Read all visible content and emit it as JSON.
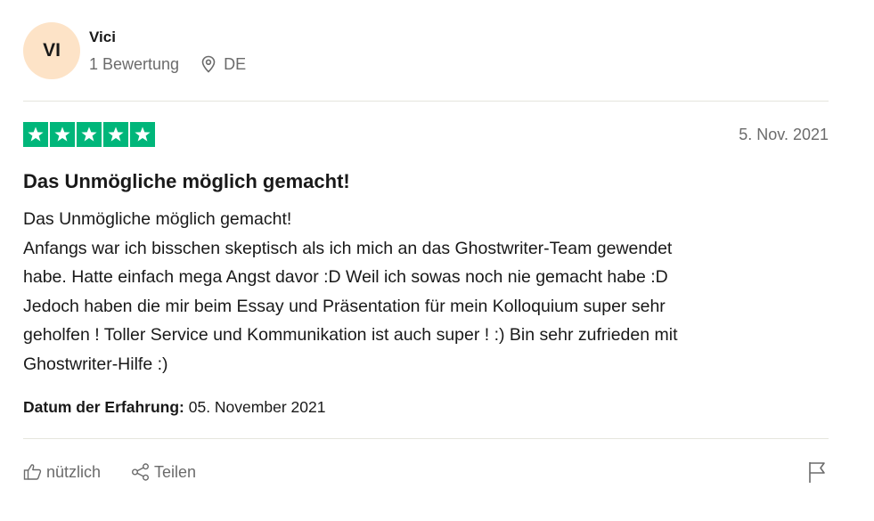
{
  "consumer": {
    "initials": "VI",
    "name": "Vici",
    "review_count": "1 Bewertung",
    "country": "DE"
  },
  "review": {
    "rating": 5,
    "date": "5. Nov. 2021",
    "title": "Das Unmögliche möglich gemacht!",
    "body_lines": [
      "Das Unmögliche möglich gemacht!",
      "Anfangs war ich bisschen skeptisch als ich mich an das Ghostwriter-Team gewendet",
      "habe. Hatte einfach mega Angst davor :D Weil ich sowas noch nie gemacht habe :D",
      "Jedoch haben die mir beim Essay und Präsentation für mein Kolloquium super sehr",
      "geholfen ! Toller Service und Kommunikation ist auch super ! :) Bin sehr zufrieden mit",
      "Ghostwriter-Hilfe :)"
    ],
    "experience_label": "Datum der Erfahrung:",
    "experience_date": "05. November 2021"
  },
  "actions": {
    "useful_label": "nützlich",
    "share_label": "Teilen"
  },
  "icons": {
    "star": "star-icon",
    "location": "location-pin-icon",
    "useful": "thumbs-up-icon",
    "share": "share-icon",
    "report": "flag-icon"
  },
  "colors": {
    "star_green": "#00b67a",
    "avatar_bg": "#fde3c7",
    "muted_text": "#6b6b6b"
  }
}
